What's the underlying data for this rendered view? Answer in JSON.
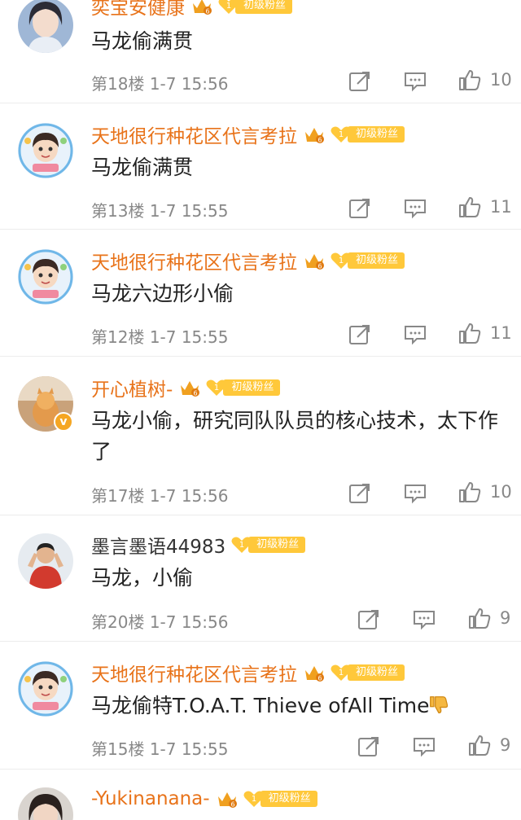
{
  "comments": [
    {
      "user": "奕宝安健康",
      "name_style": "orange",
      "text": "马龙偷满贯",
      "floor": "第18楼",
      "time": "1-7 15:56",
      "likes": "10",
      "fan_badge": "初级粉丝",
      "avatar": "woman-long-hair"
    },
    {
      "user": "天地很行种花区代言考拉",
      "name_style": "orange",
      "text": "马龙偷满贯",
      "floor": "第13楼",
      "time": "1-7 15:55",
      "likes": "11",
      "fan_badge": "初级粉丝",
      "avatar": "cartoon-boy"
    },
    {
      "user": "天地很行种花区代言考拉",
      "name_style": "orange",
      "text": "马龙六边形小偷",
      "floor": "第12楼",
      "time": "1-7 15:55",
      "likes": "11",
      "fan_badge": "初级粉丝",
      "avatar": "cartoon-boy"
    },
    {
      "user": "开心植树-",
      "name_style": "orange",
      "text": "马龙小偷，研究同队队员的核心技术，太下作了",
      "floor": "第17楼",
      "time": "1-7 15:56",
      "likes": "10",
      "fan_badge": "初级粉丝",
      "avatar": "cat-photo"
    },
    {
      "user": "墨言墨语44983",
      "name_style": "plain",
      "text": "马龙，小偷",
      "floor": "第20楼",
      "time": "1-7 15:56",
      "likes": "9",
      "fan_badge": "初级粉丝",
      "avatar": "man-red-shirt"
    },
    {
      "user": "天地很行种花区代言考拉",
      "name_style": "orange",
      "text": "马龙偷特T.O.A.T. Thieve ofAll Time",
      "floor": "第15楼",
      "time": "1-7 15:55",
      "likes": "9",
      "fan_badge": "初级粉丝",
      "avatar": "cartoon-boy"
    },
    {
      "user": "-Yukinanana-",
      "name_style": "orange",
      "text": "",
      "floor": "",
      "time": "",
      "likes": "",
      "fan_badge": "初级粉丝",
      "avatar": "woman-dark-hair"
    }
  ],
  "icons": {
    "share": "share-icon",
    "reply": "reply-icon",
    "like": "thumb-up-icon",
    "crown": "crown-icon",
    "thumb_down_emoji": "thumb-down-emoji-icon",
    "verified": "verified-badge-icon"
  },
  "colors": {
    "username": "#e8731a",
    "fan_badge": "#ffc83a",
    "meta_text": "#888888",
    "divider": "#ececec"
  }
}
